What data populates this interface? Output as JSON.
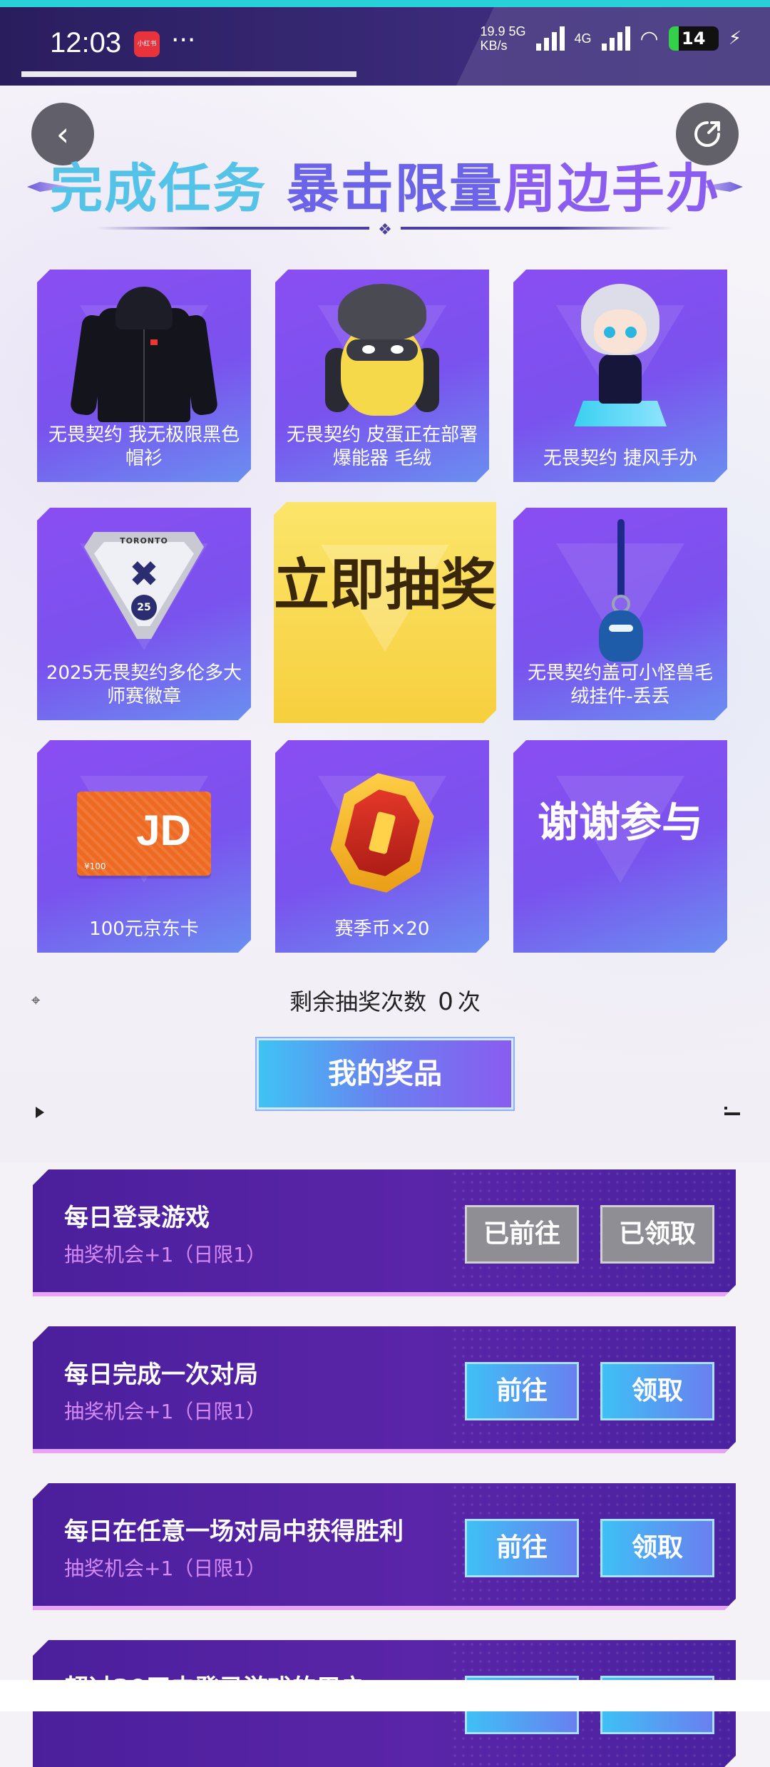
{
  "status_bar": {
    "time": "12:03",
    "app_badge": "小红书",
    "more": "···",
    "net_speed": "19.9",
    "net_unit": "KB/s",
    "net_type": "5G",
    "net_type2": "4G",
    "battery": "14"
  },
  "nav": {
    "back_icon": "chevron-left-icon",
    "share_icon": "share-icon"
  },
  "header": {
    "title_part1": "完成任务",
    "title_part2": "暴击限量",
    "title_part3": "周边手办"
  },
  "prizes": [
    {
      "label": "无畏契约 我无极限黑色帽衫",
      "icon": "hoodie"
    },
    {
      "label": "无畏契约 皮蛋正在部署爆能器 毛绒",
      "icon": "plush"
    },
    {
      "label": "无畏契约 捷风手办",
      "icon": "figure"
    },
    {
      "label": "2025无畏契约多伦多大师赛徽章",
      "icon": "badge"
    },
    {
      "label": "无畏契约盖可小怪兽毛绒挂件-丢丢",
      "icon": "keychain"
    },
    {
      "label": "100元京东卡",
      "icon": "jd-card"
    },
    {
      "label": "赛季币×20",
      "icon": "coin"
    },
    {
      "label": "谢谢参与",
      "icon": "none"
    }
  ],
  "badge_text": {
    "top": "TORONTO",
    "num": "25"
  },
  "jd_card": {
    "logo": "JD",
    "amount": "¥100"
  },
  "draw_button": "立即抽奖",
  "remaining": {
    "prefix": "剩余抽奖次数",
    "count": "0",
    "suffix": "次"
  },
  "my_prizes_button": "我的奖品",
  "tasks": [
    {
      "title": "每日登录游戏",
      "subtitle": "抽奖机会+1（日限1）",
      "go": "已前往",
      "claim": "已领取",
      "state": "done"
    },
    {
      "title": "每日完成一次对局",
      "subtitle": "抽奖机会+1（日限1）",
      "go": "前往",
      "claim": "领取",
      "state": "active"
    },
    {
      "title": "每日在任意一场对局中获得胜利",
      "subtitle": "抽奖机会+1（日限1）",
      "go": "前往",
      "claim": "领取",
      "state": "active"
    },
    {
      "title": "超过30天未登录游戏的用户，",
      "subtitle": "",
      "go": "",
      "claim": "",
      "state": "partial"
    }
  ]
}
